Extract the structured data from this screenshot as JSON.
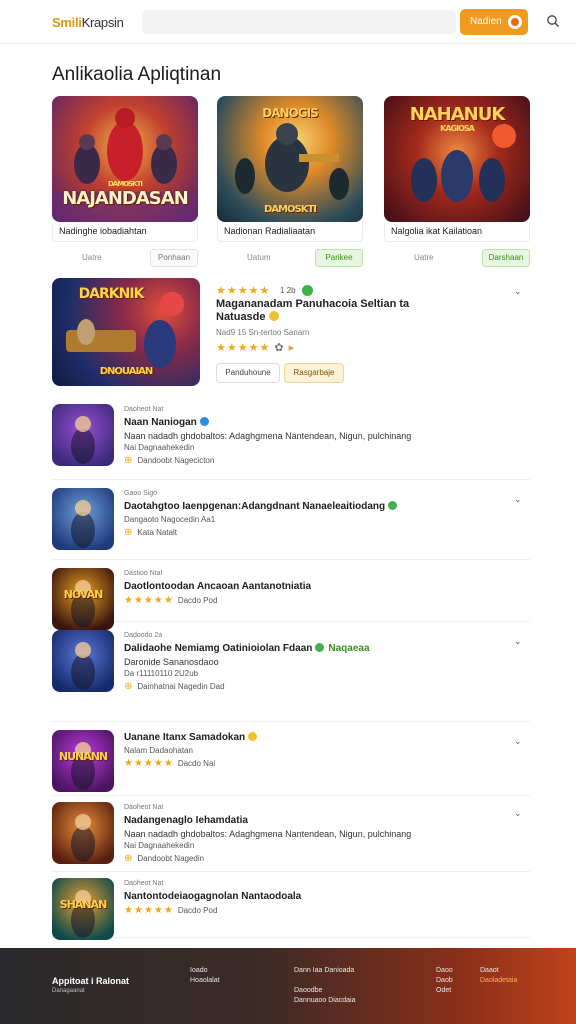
{
  "header": {
    "logo_a": "Smili",
    "logo_b": "Krapsin",
    "search_placeholder": "",
    "button_label": "Nadien"
  },
  "page_title": "Anlikaolia Apliqtinan",
  "top_cards": [
    {
      "art_text": "NAJANDASAN",
      "art_sub": "DAMOSKTI",
      "caption": "Nadinghe iobadiahtan",
      "meta": "Uatre",
      "pill": "Ponhaan",
      "pill_style": "plain",
      "bg": [
        "#7a2e8e",
        "#f0a040"
      ]
    },
    {
      "art_text": "DANOGIS",
      "art_sub": "DAMOSKTI",
      "caption": "Nadionan Radialiaatan",
      "meta": "Uatum",
      "pill": "Parikee",
      "pill_style": "green",
      "bg": [
        "#2f5f6e",
        "#f3a23a"
      ]
    },
    {
      "art_text": "NAHANUK",
      "art_sub": "KAGIOSA",
      "caption": "Nalgolia ikat Kailatioan",
      "meta": "Uatre",
      "pill": "Darshaan",
      "pill_style": "green",
      "bg": [
        "#5a1020",
        "#e8512a"
      ]
    }
  ],
  "featured": {
    "art_text": "DARKNIK",
    "art_sub": "DNOUAIAN",
    "rating_count": "1 2b",
    "title": "Magananadam Panuhacoia Seltian ta Natuasde",
    "subtitle": "Nad9 15 Sn-tertoo Sanarn",
    "button_1": "Panduhoune",
    "button_2": "Rasgarbaje"
  },
  "list": [
    {
      "l1": "Daoheot Nat",
      "l2": "Naan Naniogan",
      "l3": "Naan nadadh ghdobaltos: Adaghgmena Nantendean, Nigun, pulchinang",
      "l4": "Nai Dagnaahekedin",
      "l5": "Dandoobt  Nagecicton",
      "badge": "blue",
      "icon_bg": [
        "#3b2a7a",
        "#9a4fd6"
      ],
      "icon_text": ""
    },
    {
      "l1": "Gaoo Sigo",
      "l2": "Daotahgtoo Iaenpgenan:Adangdnant Nanaeleaitiodang",
      "l3": "",
      "l4": "Dangaoto  Nagocedin Aa1",
      "l5": "Kata Natalt",
      "badge": "green",
      "icon_bg": [
        "#1e3a7a",
        "#6fa0d8"
      ],
      "icon_text": "",
      "green_l1": true
    },
    {
      "l1": "Dastioo Ntal",
      "l2": "Daotlontoodan Ancaoan Aantanotniatia",
      "l3": "",
      "l4": "",
      "l5": "Dacdo Pod",
      "badge": "",
      "icon_bg": [
        "#3a1410",
        "#e8a020"
      ],
      "icon_text": "NOVAN"
    },
    {
      "l1": "Dadoodo 2a",
      "l2": "Dalidaohe Nemiamg Oatinioiolan Fdaan",
      "l3": "Daronide Sananosdaoo",
      "l4": "Da r11110110 2U2ub",
      "l5": "Dainhatnai Nagedin Dad",
      "badge": "green",
      "icon_bg": [
        "#152a6a",
        "#5a78d8"
      ],
      "icon_text": "",
      "extra_tag": "Naqaeaa"
    },
    {
      "l1": "",
      "l2": "Uanane Itanx Samadokan",
      "l3": "",
      "l4": "Nalam Dadaohatan",
      "l5": "Dacdo Nai",
      "badge": "yellow",
      "icon_bg": [
        "#4a1460",
        "#c03adf"
      ],
      "icon_text": "NUNANN"
    },
    {
      "l1": "Daoheot Nat",
      "l2": "Nadangenaglo Iehamdatia",
      "l3": "Naan nadadh ghdobaltos: Adaghgmena Nantendean, Nigun, pulchinang",
      "l4": "Nai Dagnaahekedin",
      "l5": "Dandoobt  Nagedin",
      "badge": "",
      "icon_bg": [
        "#5a1e10",
        "#e89038"
      ],
      "icon_text": ""
    },
    {
      "l1": "Daoheot Nat",
      "l2": "Nantontodeiaogagnolan Nantaodoala",
      "l3": "",
      "l4": "",
      "l5": "Dacdo Pod",
      "badge": "",
      "icon_bg": [
        "#0e4a4a",
        "#e8a030"
      ],
      "icon_text": "SHANAN"
    }
  ],
  "footer": {
    "logo": "Appitoat i Ralonat",
    "logo_sub": "Danagaanat",
    "col1": [
      "Ioado",
      "Hoaolalat"
    ],
    "col2": [
      "Dann Iaa Danioada",
      "",
      "Daoodbe",
      "Dannuaoo Diacdaia"
    ],
    "col3": [
      "Daoo",
      "Daob",
      "Odet"
    ],
    "col4": [
      "Daaot",
      "Daoladetaia"
    ]
  },
  "colors": {
    "accent": "#f09a22",
    "star": "#f0a818",
    "green": "#3fb24b"
  }
}
